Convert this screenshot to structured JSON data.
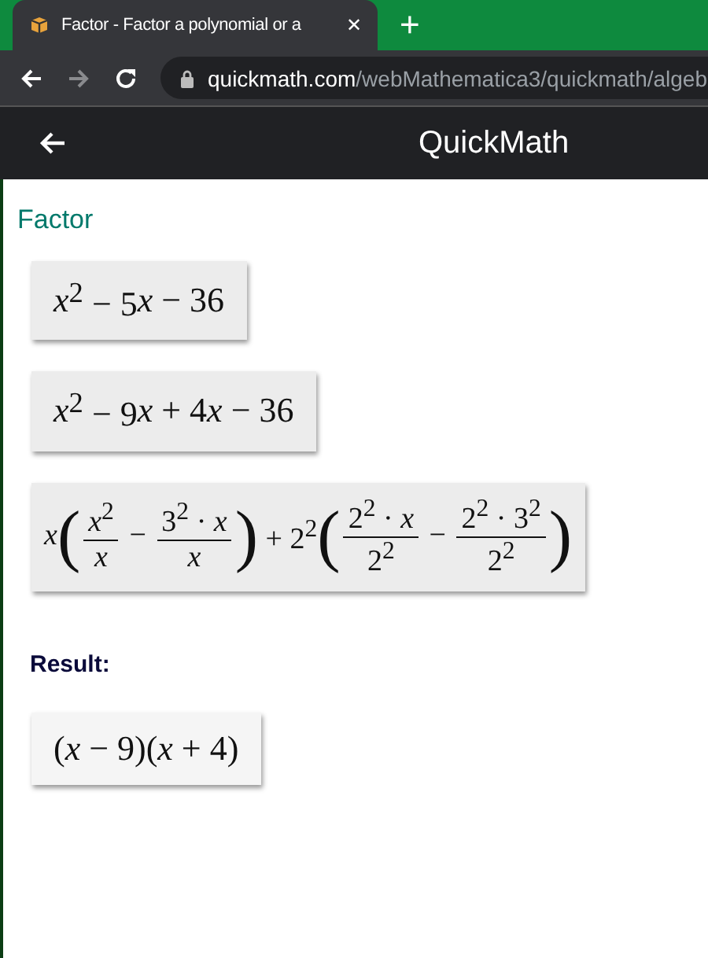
{
  "browser": {
    "tab": {
      "title": "Factor - Factor a polynomial or a",
      "close": "✕"
    },
    "new_tab": "+",
    "url": {
      "host": "quickmath.com",
      "path": "/webMathematica3/quickmath/algeb"
    }
  },
  "app_bar": {
    "title": "QuickMath"
  },
  "heading": "Factor",
  "steps": [
    {
      "tokens": [
        {
          "kind": "var",
          "t": "x"
        },
        {
          "kind": "text",
          "t": "$^{2}$ − 5"
        },
        {
          "kind": "var",
          "t": "x"
        },
        {
          "kind": "text",
          "t": " − 36"
        }
      ]
    },
    {
      "tokens": [
        {
          "kind": "var",
          "t": "x"
        },
        {
          "kind": "text",
          "t": "$^{2}$ − 9"
        },
        {
          "kind": "var",
          "t": "x"
        },
        {
          "kind": "text",
          "t": " + 4"
        },
        {
          "kind": "var",
          "t": "x"
        },
        {
          "kind": "text",
          "t": " − 36"
        }
      ]
    },
    {
      "tokens": [
        {
          "kind": "var",
          "t": "x"
        },
        {
          "kind": "paren",
          "t": "("
        },
        {
          "kind": "frac",
          "num": "*x*$^{2}$",
          "den": "*x*"
        },
        {
          "kind": "text",
          "t": " − "
        },
        {
          "kind": "frac",
          "num": "3$^{2}$ · *x*",
          "den": "*x*"
        },
        {
          "kind": "paren",
          "t": ")"
        },
        {
          "kind": "text",
          "t": " + 2$^{2}$"
        },
        {
          "kind": "paren",
          "t": "("
        },
        {
          "kind": "frac",
          "num": "2$^{2}$ · *x*",
          "den": "2$^{2}$"
        },
        {
          "kind": "text",
          "t": " − "
        },
        {
          "kind": "frac",
          "num": "2$^{2}$ · 3$^{2}$",
          "den": "2$^{2}$"
        },
        {
          "kind": "paren",
          "t": ")"
        }
      ]
    }
  ],
  "result_label": "Result:",
  "result": {
    "tokens": [
      {
        "kind": "text",
        "t": "("
      },
      {
        "kind": "var",
        "t": "x"
      },
      {
        "kind": "text",
        "t": " − 9)("
      },
      {
        "kind": "var",
        "t": "x"
      },
      {
        "kind": "text",
        "t": " + 4)"
      }
    ]
  }
}
